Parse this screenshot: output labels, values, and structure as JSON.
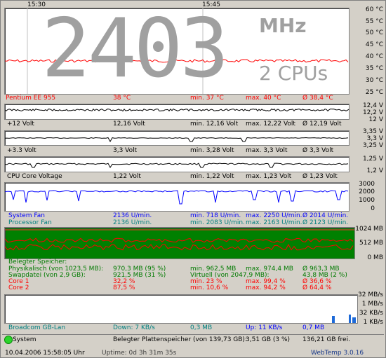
{
  "time_marks": [
    "15:30",
    "15:45"
  ],
  "temp_panel": {
    "big_value": "2403",
    "big_unit": "MHz",
    "big_cpus": "2 CPUs",
    "scale": [
      "60 °C",
      "55 °C",
      "50 °C",
      "45 °C",
      "40 °C",
      "35 °C",
      "30 °C",
      "25 °C"
    ],
    "label": "Pentium EE 955",
    "current": "38 °C",
    "min": "min. 37 °C",
    "max": "max. 40 °C",
    "avg": "Ø 38,4 °C",
    "line_color": "#ff0000"
  },
  "v12_panel": {
    "scale": [
      "12,4 V",
      "12,2 V",
      "12 V"
    ],
    "label": "+12 Volt",
    "current": "12,16 Volt",
    "min": "min. 12,16 Volt",
    "max": "max. 12,22 Volt",
    "avg": "Ø 12,19 Volt"
  },
  "v33_panel": {
    "scale": [
      "3,35 V",
      "3,3 V",
      "3,25 V"
    ],
    "label": "+3.3 Volt",
    "current": "3,3 Volt",
    "min": "min. 3,28 Volt",
    "max": "max. 3,3 Volt",
    "avg": "Ø 3,3 Volt"
  },
  "core_panel": {
    "scale": [
      "1,25 V",
      "1,2 V"
    ],
    "label": "CPU Core Voltage",
    "current": "1,22 Volt",
    "min": "min. 1,22 Volt",
    "max": "max. 1,23 Volt",
    "avg": "Ø 1,23 Volt"
  },
  "fan_panel": {
    "scale": [
      "3000",
      "2000",
      "1000",
      "0"
    ],
    "rows": [
      {
        "label": "System Fan",
        "current": "2136 U/min.",
        "min": "min. 718 U/min.",
        "max": "max. 2250 U/min.",
        "avg": "Ø 2014 U/min."
      },
      {
        "label": "Processor Fan",
        "current": "2136 U/min.",
        "min": "min. 2083 U/min.",
        "max": "max. 2163 U/min.",
        "avg": "Ø 2123 U/min."
      }
    ],
    "line_color": "#0000ff"
  },
  "mem_panel": {
    "scale": [
      "1024 MB",
      "512 MB",
      "0 MB"
    ],
    "header": "Belegter Speicher:",
    "rows": [
      {
        "label": "Physikalisch (von 1023,5 MB):",
        "current": "970,3 MB (95 %)",
        "min": "min. 962,5 MB",
        "max": "max. 974,4 MB",
        "avg": "Ø 963,3 MB"
      },
      {
        "label": "Swapdatei (von 2,9 GB):",
        "current": "921,5 MB (31 %)",
        "min": "Virtuell (von 2047,9 MB):",
        "max": "",
        "avg": "43,8 MB (2 %)"
      },
      {
        "label": "Core 1",
        "current": "32,2 %",
        "min": "min. 23 %",
        "max": "max. 99,4 %",
        "avg": "Ø 36,6 %"
      },
      {
        "label": "Core 2",
        "current": "87,5 %",
        "min": "min. 10,6 %",
        "max": "max. 94,2 %",
        "avg": "Ø 64,4 %"
      }
    ],
    "bg_color": "#008000"
  },
  "net_panel": {
    "scale": [
      "32 MB/s",
      "1 MB/s",
      "32 KB/s",
      "1 KB/s"
    ],
    "label": "Broadcom GB-Lan",
    "down": "Down: 7 KB/s",
    "down_total": "0,3 MB",
    "up": "Up: 11 KB/s",
    "up_total": "0,7 MB"
  },
  "status": {
    "name": "System",
    "disk_label": "Belegter Plattenspeicher (von 139,73 GB):",
    "disk_used": "3,51 GB (3 %)",
    "disk_free": "136,21 GB frei."
  },
  "bottom": {
    "datetime": "10.04.2006 15:58:05 Uhr",
    "uptime": "Uptime: 0d 3h 31m 35s",
    "app": "WebTemp 3.0.16"
  }
}
